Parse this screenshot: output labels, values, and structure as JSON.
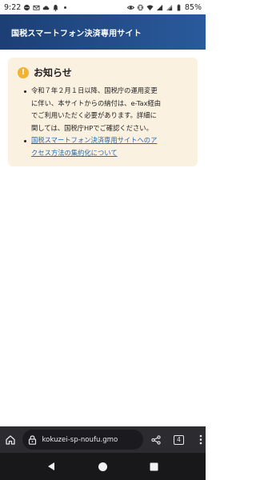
{
  "status_bar": {
    "time": "9:22",
    "battery_pct": "85%",
    "left_icons": [
      "chat-icon",
      "mail-icon",
      "cloud-icon",
      "notification-bell-icon",
      "dot-icon"
    ],
    "right_icons": [
      "eye-icon",
      "vibrate-icon",
      "wifi-icon",
      "signal-icon",
      "signal-icon",
      "battery-icon"
    ]
  },
  "header": {
    "title": "国税スマートフォン決済専用サイト",
    "background": "#1f4a87"
  },
  "notice": {
    "icon": "!",
    "title": "お知らせ",
    "items": [
      {
        "lines": [
          "令和７年２月１日以降、国税庁の運用変更",
          "に伴い、本サイトからの納付は、e-Tax経由",
          "でご利用いただく必要があります。詳細に",
          "関しては、国税庁HPでご確認ください。"
        ]
      },
      {
        "lines": [
          "国税スマートフォン決済専用サイトへのア",
          "クセス方法の集約化について"
        ],
        "is_link": true
      }
    ]
  },
  "browser": {
    "url": "kokuzei-sp-noufu.gmo",
    "tab_count": "4",
    "icons": [
      "home-icon",
      "lock-icon",
      "share-icon",
      "menu-icon"
    ]
  },
  "nav": {
    "icons": [
      "back-icon",
      "home-circle-icon",
      "recents-icon"
    ]
  },
  "colors": {
    "header": "#1f4a87",
    "notice_bg": "#fbf1e0",
    "notice_icon": "#f2b233",
    "link": "#2a6cb3"
  }
}
